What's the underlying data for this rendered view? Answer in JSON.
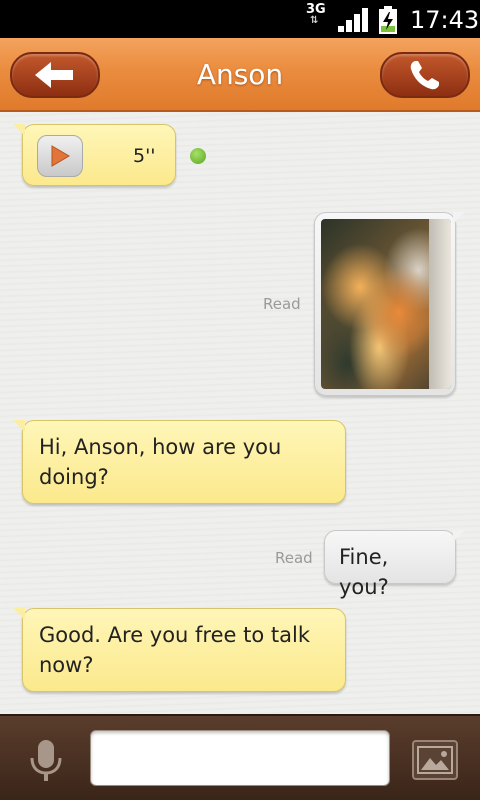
{
  "status_bar": {
    "network": "3G",
    "time": "17:43"
  },
  "header": {
    "title": "Anson"
  },
  "messages": {
    "voice": {
      "duration": "5''"
    },
    "image": {
      "status": "Read"
    },
    "msg1": {
      "text": "Hi, Anson, how are you doing?"
    },
    "msg2": {
      "text": "Fine, you?",
      "status": "Read"
    },
    "msg3": {
      "text": "Good. Are you free to talk now?"
    }
  },
  "input": {
    "placeholder": ""
  },
  "colors": {
    "header": "#ea8c3e",
    "incoming_bubble": "#fbe98c",
    "outgoing_bubble": "#e4e4e4",
    "unread_dot": "#7cc23c",
    "input_bar": "#4a3022"
  },
  "icons": {
    "back": "arrow-left-icon",
    "call": "phone-icon",
    "play": "play-icon",
    "mic": "microphone-icon",
    "picture": "image-icon"
  }
}
